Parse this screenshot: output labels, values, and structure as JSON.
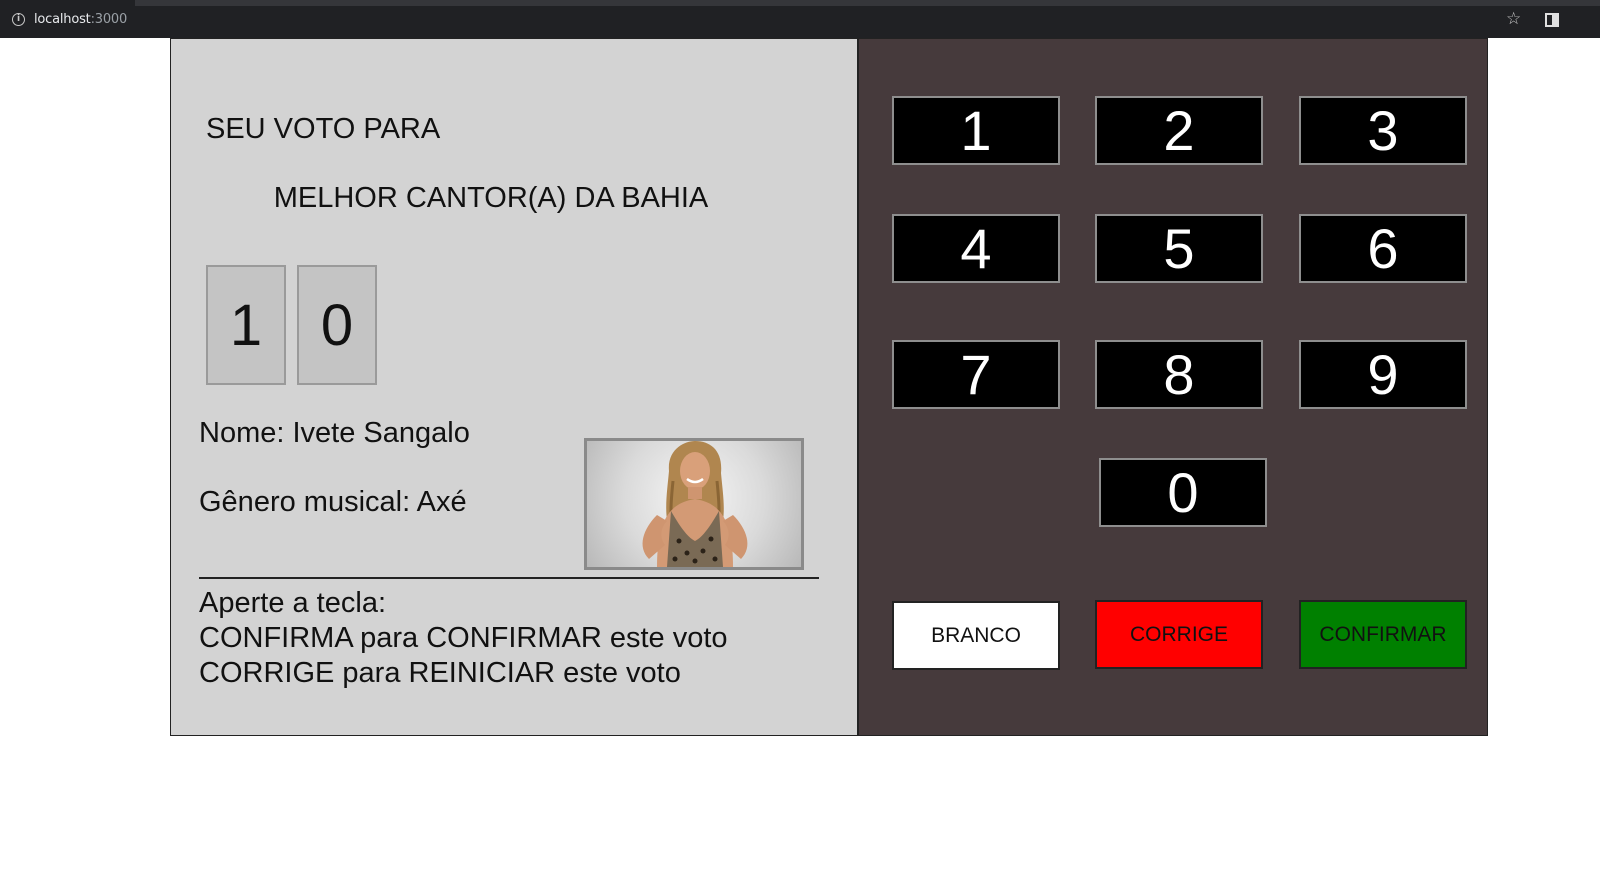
{
  "browser": {
    "url_host": "localhost",
    "url_port": ":3000"
  },
  "screen": {
    "heading": "SEU VOTO PARA",
    "office": "MELHOR CANTOR(A) DA BAHIA",
    "digits": [
      "1",
      "0"
    ],
    "candidate_name": "Nome: Ivete Sangalo",
    "candidate_genre": "Gênero musical: Axé",
    "instructions": [
      "Aperte a tecla:",
      "CONFIRMA para CONFIRMAR este voto",
      "CORRIGE para REINICIAR este voto"
    ]
  },
  "keypad": {
    "keys": [
      "1",
      "2",
      "3",
      "4",
      "5",
      "6",
      "7",
      "8",
      "9",
      "0"
    ],
    "branco_label": "BRANCO",
    "corrige_label": "CORRIGE",
    "confirmar_label": "CONFIRMAR"
  },
  "colors": {
    "screen_bg": "#d3d3d3",
    "keypad_bg": "#463a3c",
    "branco": "#ffffff",
    "corrige": "#ff0000",
    "confirmar": "#008000"
  }
}
